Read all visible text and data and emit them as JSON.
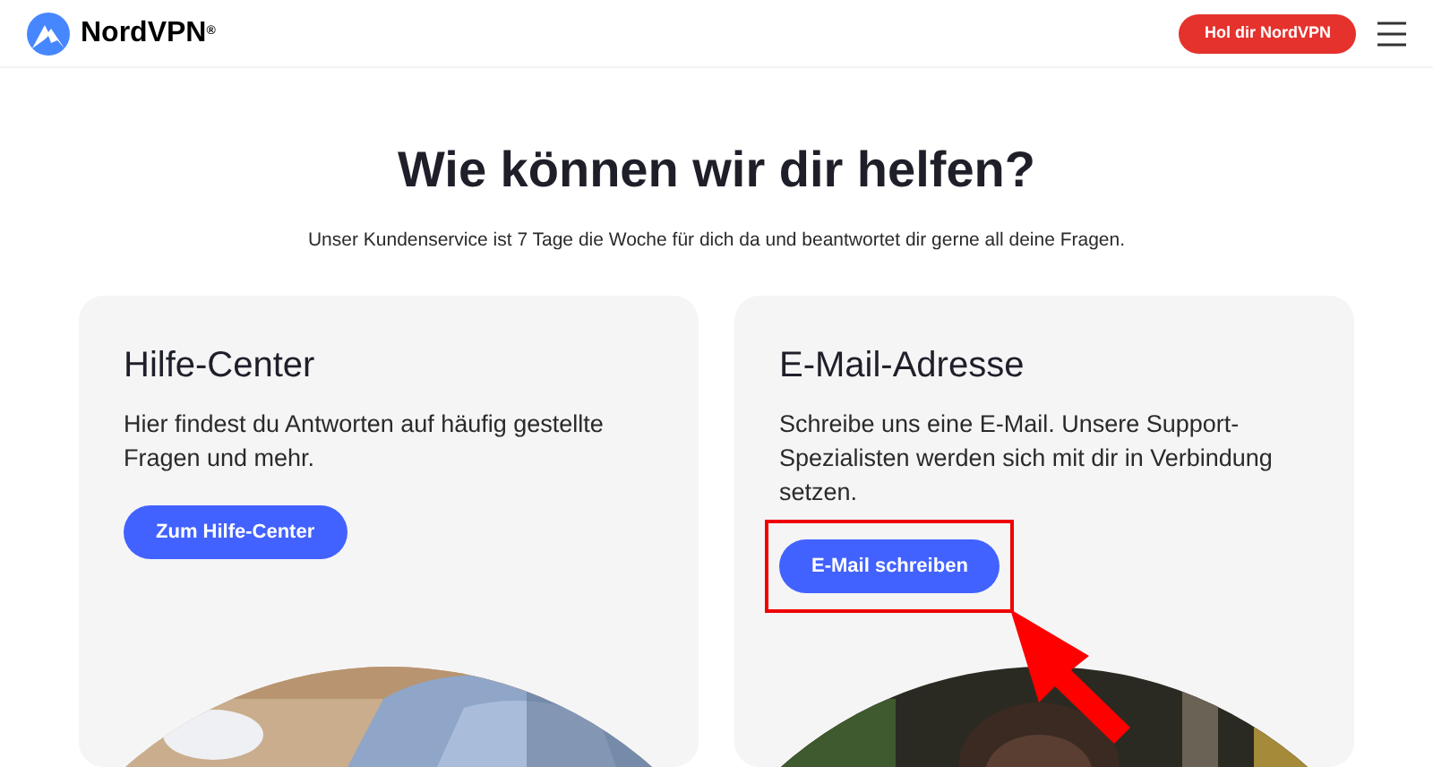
{
  "header": {
    "brand": "NordVPN",
    "brand_mark": "®",
    "cta": "Hol dir NordVPN"
  },
  "hero": {
    "title": "Wie können wir dir helfen?",
    "subtitle": "Unser Kundenservice ist 7 Tage die Woche für dich da und beantwortet dir gerne all deine Fragen."
  },
  "cards": [
    {
      "title": "Hilfe-Center",
      "text": "Hier findest du Antworten auf häufig gestellte Fragen und mehr.",
      "button": "Zum Hilfe-Center",
      "highlighted": false
    },
    {
      "title": "E-Mail-Adresse",
      "text": "Schreibe uns eine E-Mail. Unsere Support-Spezialisten werden sich mit dir in Verbindung setzen.",
      "button": "E-Mail schreiben",
      "highlighted": true
    }
  ]
}
